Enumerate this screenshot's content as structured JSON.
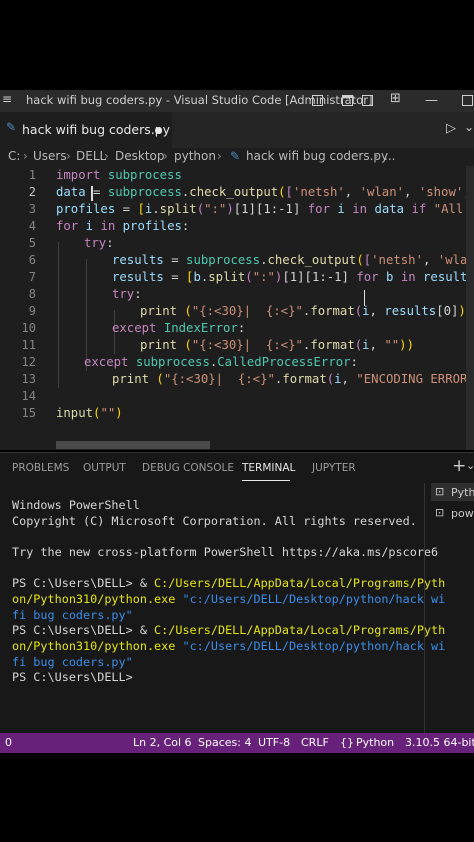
{
  "window": {
    "title": "hack wifi bug coders.py - Visual Studio Code [Administrator]"
  },
  "tab": {
    "filename": "hack wifi bug coders.py"
  },
  "breadcrumb": {
    "drive": "C:",
    "parts": [
      "Users",
      "DELL",
      "Desktop",
      "python"
    ],
    "file": "hack wifi bug coders.py",
    "more": "..."
  },
  "editor": {
    "line_numbers": [
      "1",
      "2",
      "3",
      "4",
      "5",
      "6",
      "7",
      "8",
      "9",
      "10",
      "11",
      "12",
      "13",
      "14",
      "15"
    ],
    "lines": {
      "l1": [
        "import",
        " ",
        "subprocess"
      ],
      "l2": [
        "data",
        " = ",
        "subprocess",
        ".",
        "check_output",
        "(",
        "[",
        "'netsh'",
        ", ",
        "'wlan'",
        ", ",
        "'show'",
        ", "
      ],
      "l3": [
        "profiles",
        " = ",
        "[",
        "i",
        ".",
        "split",
        "(",
        "\":\"",
        ")",
        "[1][1:-1]",
        " ",
        "for",
        " ",
        "i",
        " ",
        "in",
        " ",
        "data",
        " ",
        "if",
        " ",
        "\"All Us"
      ],
      "l4": [
        "for",
        " ",
        "i",
        " ",
        "in",
        " ",
        "profiles",
        ":"
      ],
      "l5": [
        "try",
        ":"
      ],
      "l6": [
        "results",
        " = ",
        "subprocess",
        ".",
        "check_output",
        "(",
        "[",
        "'netsh'",
        ", ",
        "'wlan"
      ],
      "l7": [
        "results",
        " = ",
        "[",
        "b",
        ".",
        "split",
        "(",
        "\":\"",
        ")",
        "[1][1:-1]",
        " ",
        "for",
        " ",
        "b",
        " ",
        "in",
        " ",
        "results"
      ],
      "l8": [
        "try",
        ":"
      ],
      "l9": [
        "print",
        " (",
        "\"{:<30}|  {:<}\"",
        ".",
        "format",
        "(",
        "i",
        ", ",
        "results",
        "[0]",
        "))"
      ],
      "l10": [
        "except",
        " ",
        "IndexError",
        ":"
      ],
      "l11": [
        "print",
        " (",
        "\"{:<30}|  {:<}\"",
        ".",
        "format",
        "(",
        "i",
        ", ",
        "\"\"",
        "))"
      ],
      "l12": [
        "except",
        " ",
        "subprocess",
        ".",
        "CalledProcessError",
        ":"
      ],
      "l13": [
        "print",
        " (",
        "\"{:<30}|  {:<}\"",
        ".",
        "format",
        "(",
        "i",
        ", ",
        "\"ENCODING ERROR\""
      ],
      "l15": [
        "input",
        "(",
        "\"\"",
        ")"
      ]
    }
  },
  "panel": {
    "tabs": [
      "PROBLEMS",
      "OUTPUT",
      "DEBUG CONSOLE",
      "TERMINAL",
      "JUPYTER"
    ],
    "active_tab": "TERMINAL",
    "side_items": [
      "Pyth",
      "pow"
    ],
    "terminal": {
      "t1": "Windows PowerShell",
      "t2": "Copyright (C) Microsoft Corporation. All rights reserved.",
      "t3": "Try the new cross-platform PowerShell https://aka.ms/pscore6",
      "prompt": "PS C:\\Users\\DELL> & ",
      "exe1": "C:/Users/DELL/AppData/Local/Programs/Pyth",
      "exe2": "on/Python310/python.exe",
      "arg1": " \"c:/Users/DELL/Desktop/python/hack wi",
      "arg2": "fi bug coders.py\"",
      "final_prompt": "PS C:\\Users\\DELL>"
    }
  },
  "status": {
    "left": "0",
    "position": "Ln 2, Col 6",
    "spaces": "Spaces: 4",
    "encoding": "UTF-8",
    "eol": "CRLF",
    "language": "Python",
    "interpreter": "3.10.5 64-bit"
  }
}
